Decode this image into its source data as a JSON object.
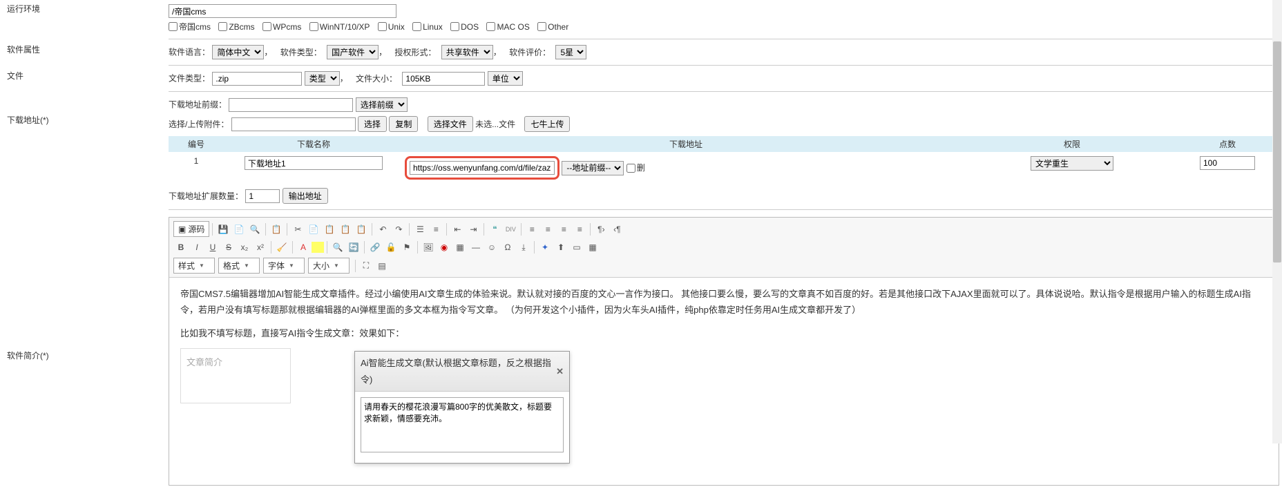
{
  "labels": {
    "runEnv": "运行环境",
    "softAttr": "软件属性",
    "file": "文件",
    "dlAddr": "下载地址(*)",
    "softIntro": "软件简介(*)"
  },
  "runEnv": {
    "value": "/帝国cms",
    "checkboxes": [
      "帝国cms",
      "ZBcms",
      "WPcms",
      "WinNT/10/XP",
      "Unix",
      "Linux",
      "DOS",
      "MAC OS",
      "Other"
    ]
  },
  "softAttr": {
    "langLabel": "软件语言：",
    "langValue": "简体中文",
    "typeLabel": "软件类型：",
    "typeValue": "国产软件",
    "authLabel": "授权形式：",
    "authValue": "共享软件",
    "rateLabel": "软件评价：",
    "rateValue": "5星"
  },
  "fileRow": {
    "ftypeLabel": "文件类型：",
    "ftypeValue": ".zip",
    "classValue": "类型",
    "fsizeLabel": "文件大小：",
    "fsizeValue": "105KB",
    "unitValue": "单位"
  },
  "download": {
    "prefixLabel": "下载地址前缀：",
    "prefixValue": "",
    "prefixSelect": "选择前缀",
    "uploadLabel": "选择/上传附件：",
    "btnSelect": "选择",
    "btnCopy": "复制",
    "btnChooseFile": "选择文件",
    "noFile": "未选...文件",
    "btnQiniu": "七牛上传",
    "headers": {
      "no": "编号",
      "name": "下载名称",
      "addr": "下载地址",
      "perm": "权限",
      "count": "点数"
    },
    "rows": [
      {
        "no": "1",
        "name": "下载地址1",
        "url": "https://oss.wenyunfang.com/d/file/zazhi/ruar",
        "urlprefix": "--地址前缀--",
        "delLabel": "删",
        "perm": "文学重生",
        "count": "100"
      }
    ],
    "extLabel": "下载地址扩展数量：",
    "extValue": "1",
    "btnOutput": "输出地址"
  },
  "editor": {
    "srcLabel": "源码",
    "combos": {
      "style": "样式",
      "format": "格式",
      "font": "字体",
      "size": "大小"
    },
    "sample1": "帝国CMS7.5编辑器增加AI智能生成文章插件。经过小编使用AI文章生成的体验来说。默认就对接的百度的文心一言作为接口。 其他接口要么慢，要么写的文章真不如百度的好。若是其他接口改下AJAX里面就可以了。具体说说哈。默认指令是根据用户输入的标题生成AI指令，若用户没有填写标题那就根据编辑器的AI弹框里面的多文本框为指令写文章。 （为何开发这个小插件，因为火车头AI插件，纯php依靠定时任务用AI生成文章都开发了）",
    "sample2": "比如我不填写标题，直接写AI指令生成文章：效果如下：",
    "summaryPlaceholder": "文章简介"
  },
  "aiDialog": {
    "title": "Ai智能生成文章(默认根据文章标题，反之根据指令)",
    "content": "请用春天的樱花浪漫写篇800字的优美散文，标题要求新颖，情感要充沛。"
  }
}
